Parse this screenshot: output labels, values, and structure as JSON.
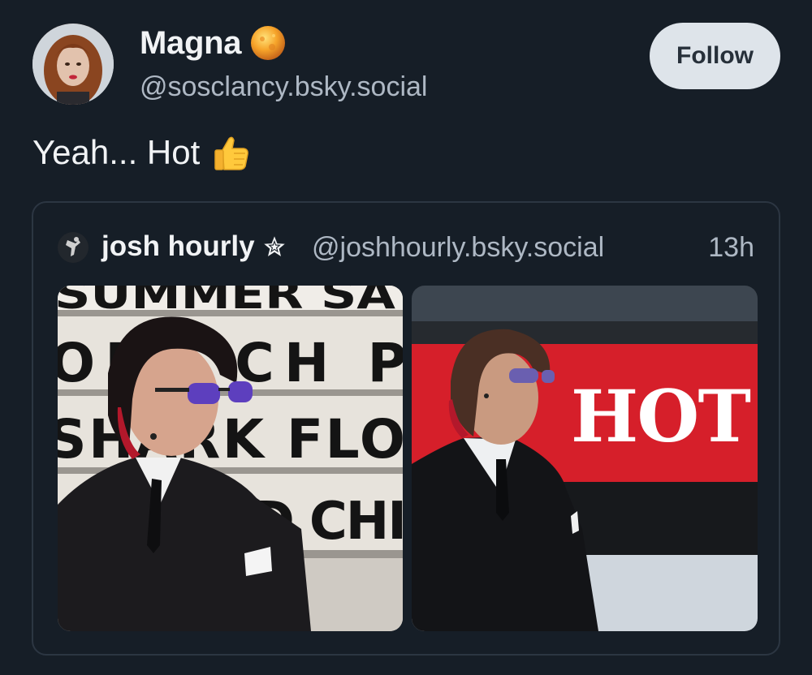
{
  "post": {
    "author": {
      "display_name": "Magna",
      "handle": "@sosclancy.bsky.social",
      "avatar_icon": "profile-avatar",
      "badge_icon": "orange-orb-icon"
    },
    "follow_label": "Follow",
    "text": "Yeah... Hot",
    "emoji_icon": "thumbs-up-icon"
  },
  "quote": {
    "author": {
      "display_name": "josh hourly",
      "star_icon": "star-icon",
      "handle": "@joshhourly.bsky.social",
      "avatar_icon": "profile-avatar"
    },
    "time": "13h",
    "images": [
      {
        "name": "photo-left",
        "marquee_rows": [
          "SUMMER SA",
          "ONE CH P",
          "SHARK FLO",
          "RED CHI"
        ]
      },
      {
        "name": "photo-right",
        "sign_text": "HOT"
      }
    ]
  },
  "colors": {
    "background": "#161e27",
    "text_primary": "#f1f3f5",
    "text_secondary": "#aeb8c4",
    "button_bg": "#dee4ea",
    "button_text": "#27303a",
    "card_border": "#2c3642",
    "sign_red": "#d61f2a"
  }
}
